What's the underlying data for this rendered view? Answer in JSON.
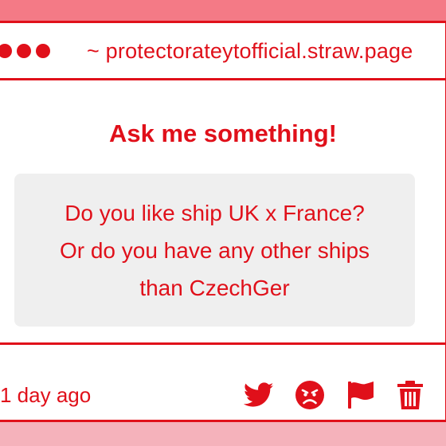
{
  "window": {
    "url": "~ protectorateytofficial.straw.page"
  },
  "main": {
    "heading": "Ask me something!",
    "question_lines": [
      "Do you like ship UK x France?",
      "Or do you have any other ships",
      "than CzechGer"
    ]
  },
  "footer": {
    "timestamp": "1 day ago",
    "actions": [
      "twitter-icon",
      "angry-face-icon",
      "flag-icon",
      "trash-icon"
    ]
  },
  "colors": {
    "accent": "#e0101a",
    "background_top": "#f47a86",
    "background_bottom": "#f5b2bb",
    "question_box": "#efefef"
  }
}
